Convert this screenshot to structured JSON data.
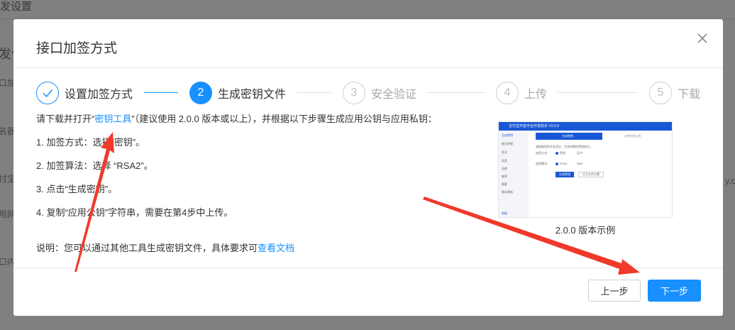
{
  "background": {
    "page_title": "发设置",
    "section_heading": "发化",
    "side_snippets": [
      "口加",
      "名器",
      "付宝",
      "用网",
      "口内"
    ],
    "right_snippet": "y.c"
  },
  "modal": {
    "title": "接口加签方式",
    "close_icon": "close-icon",
    "steps": [
      {
        "number": "1",
        "label": "设置加签方式",
        "status": "done"
      },
      {
        "number": "2",
        "label": "生成密钥文件",
        "status": "active"
      },
      {
        "number": "3",
        "label": "安全验证",
        "status": "wait"
      },
      {
        "number": "4",
        "label": "上传",
        "status": "wait"
      },
      {
        "number": "5",
        "label": "下载",
        "status": "wait"
      }
    ],
    "intro": {
      "prefix": "请下载并打开“",
      "link": "密钥工具",
      "suffix": "”（建议使用 2.0.0 版本或以上），并根据以下步骤生成应用公钥与应用私钥："
    },
    "instructions": [
      "1. 加签方式：选择“密钥”。",
      "2. 加签算法：选择 “RSA2”。",
      "3. 点击“生成密钥”。",
      "4. 复制“应用公钥”字符串，需要在第4步中上传。"
    ],
    "note": {
      "prefix": "说明：您可以通过其他工具生成密钥文件，具体要求可",
      "link": "查看文档"
    },
    "preview": {
      "caption": "2.0.0 版本示例",
      "window_title": "支付宝开放平台开发助手 V2.0.0",
      "sidebar_items": [
        "生成密钥",
        "格式转换",
        "签名",
        "验签",
        "加密",
        "解密",
        "摘要",
        "版本更新"
      ],
      "tab_active": "生成密钥",
      "tab_inactive": "上传应用公钥",
      "desc": "请根据您的开发语言，生成所需的密钥格式。",
      "row1_label": "加签方式：",
      "row1_options": [
        "密钥",
        "证书"
      ],
      "row2_label": "加签算法：",
      "row2_options": [
        "RSA2",
        "SM2"
      ],
      "btn_generate": "生成密钥",
      "btn_open": "打开文件位置",
      "footer_link": "帮助"
    },
    "buttons": {
      "prev": "上一步",
      "next": "下一步"
    },
    "colors": {
      "primary": "#1890ff",
      "annotation_arrow": "#f0392b"
    }
  }
}
